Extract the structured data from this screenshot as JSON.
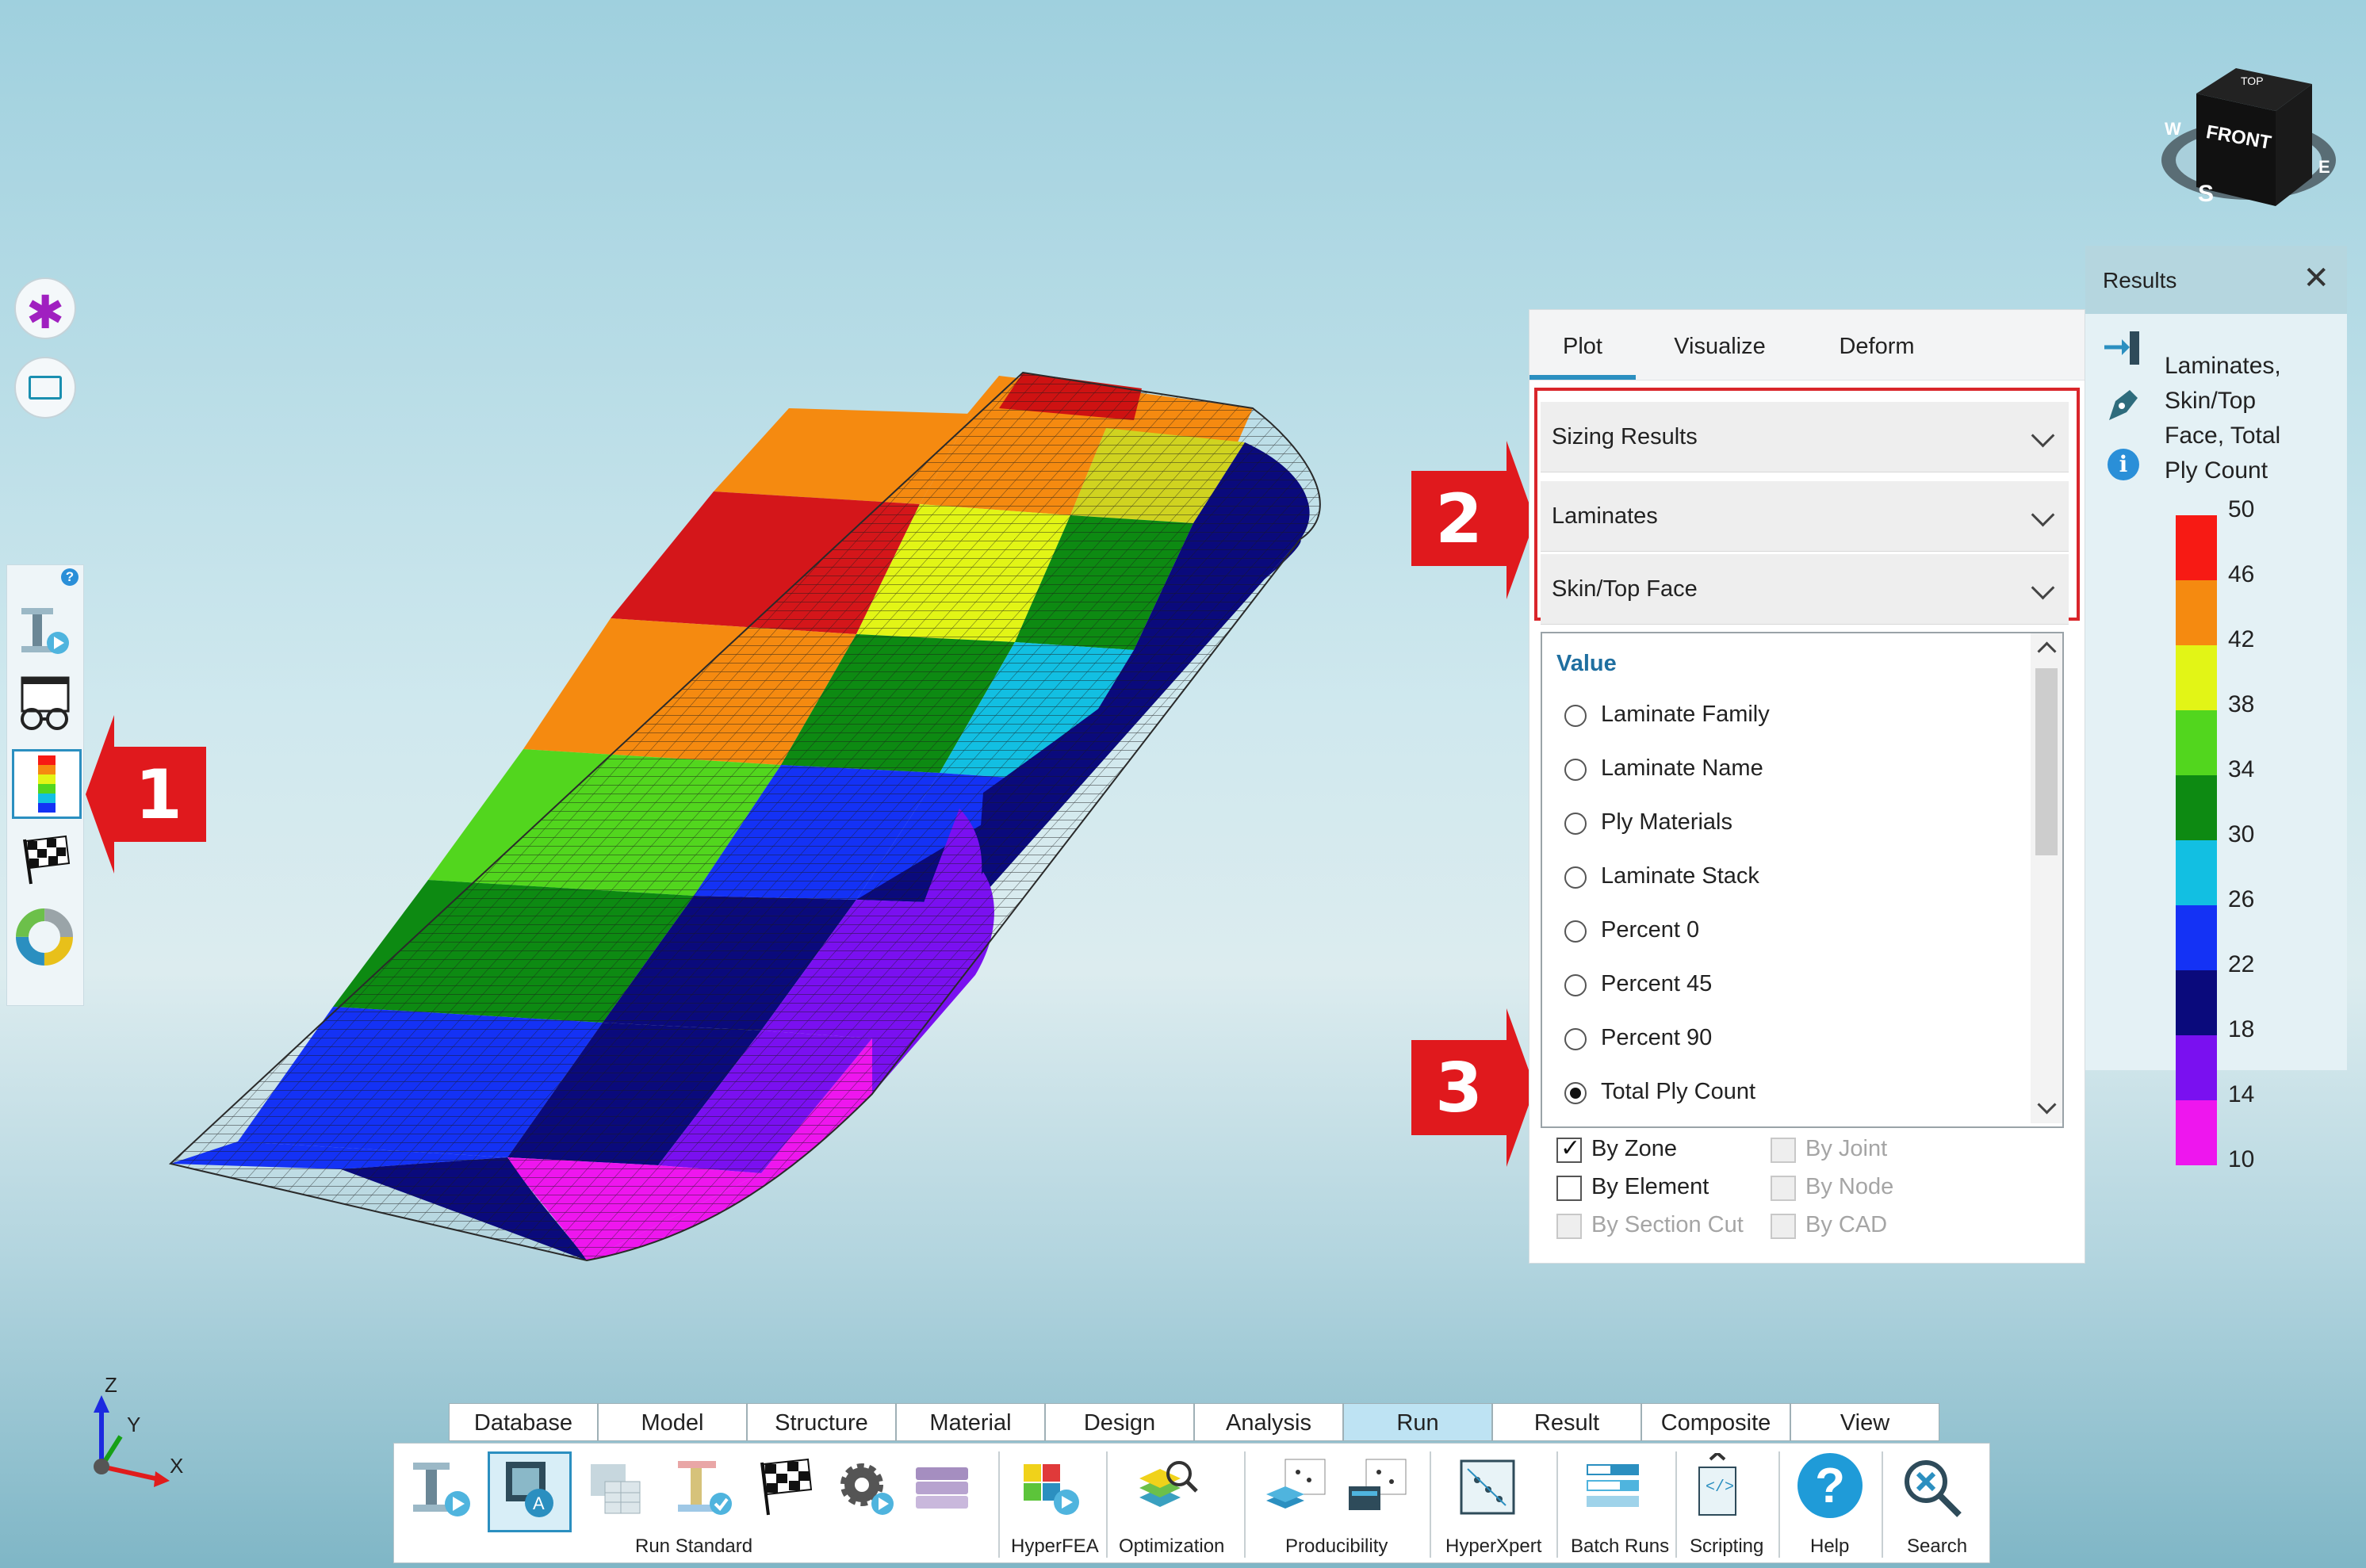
{
  "navcube": {
    "front": "FRONT",
    "top": "TOP",
    "compass_s": "S",
    "compass_w": "W",
    "compass_e": "E"
  },
  "axes": {
    "z": "Z",
    "y": "Y",
    "x": "X"
  },
  "panel": {
    "tabs": [
      "Plot",
      "Visualize",
      "Deform"
    ],
    "dropdowns": [
      "Sizing Results",
      "Laminates",
      "Skin/Top Face"
    ],
    "value_header": "Value",
    "values": [
      "Laminate Family",
      "Laminate Name",
      "Ply Materials",
      "Laminate Stack",
      "Percent 0",
      "Percent 45",
      "Percent 90",
      "Total Ply Count"
    ],
    "selected_value": "Total Ply Count",
    "checkboxes": [
      {
        "label": "By Zone",
        "checked": true,
        "enabled": true
      },
      {
        "label": "By Joint",
        "checked": false,
        "enabled": false
      },
      {
        "label": "By Element",
        "checked": false,
        "enabled": true
      },
      {
        "label": "By Node",
        "checked": false,
        "enabled": false
      },
      {
        "label": "By Section Cut",
        "checked": false,
        "enabled": false
      },
      {
        "label": "By CAD",
        "checked": false,
        "enabled": false
      }
    ]
  },
  "results": {
    "title": "Results",
    "description": [
      "Laminates,",
      "Skin/Top",
      "Face, Total",
      "Ply Count"
    ],
    "legend_labels": [
      "50",
      "46",
      "42",
      "38",
      "34",
      "30",
      "26",
      "22",
      "18",
      "14",
      "10"
    ],
    "legend_colors": [
      "#f71a14",
      "#f58a10",
      "#e2f516",
      "#52d61e",
      "#0d8a12",
      "#12bfe2",
      "#1432f5",
      "#0a0a7c",
      "#7a10f0",
      "#ee16ee"
    ]
  },
  "callouts": [
    "1",
    "2",
    "3"
  ],
  "ribbon": {
    "tabs": [
      "Database",
      "Model",
      "Structure",
      "Material",
      "Design",
      "Analysis",
      "Run",
      "Result",
      "Composite",
      "View"
    ],
    "active_tab": "Run",
    "groups": [
      "Run Standard",
      "HyperFEA",
      "Optimization",
      "Producibility",
      "HyperXpert",
      "Batch Runs",
      "Scripting",
      "Help",
      "Search"
    ]
  },
  "colors": {
    "accent": "#2b8fc0",
    "callout": "#e0191d"
  }
}
